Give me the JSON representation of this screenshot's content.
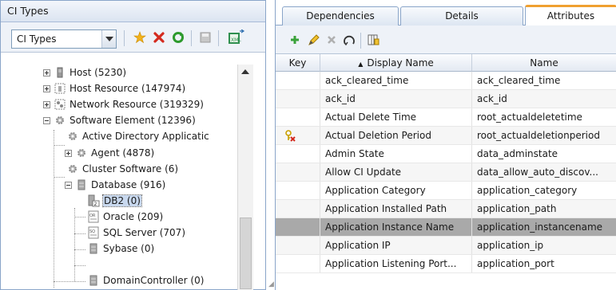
{
  "left_panel": {
    "title": "CI Types",
    "selector_value": "CI Types",
    "toolbar_icons": [
      "star-icon",
      "delete-icon",
      "refresh-icon",
      "save-icon",
      "export-xml-icon"
    ]
  },
  "tree": [
    {
      "label": "Host (5230)",
      "icon": "host-icon",
      "expander": "plus"
    },
    {
      "label": "Host Resource (147974)",
      "icon": "host-resource-icon",
      "expander": "plus"
    },
    {
      "label": "Network Resource (319329)",
      "icon": "network-resource-icon",
      "expander": "plus"
    },
    {
      "label": "Software Element (12396)",
      "icon": "gear-icon",
      "expander": "minus"
    },
    {
      "label": "Active Directory Applicatic",
      "icon": "gear-icon",
      "expander": ""
    },
    {
      "label": "Agent (4878)",
      "icon": "gear-icon",
      "expander": "plus"
    },
    {
      "label": "Cluster Software (6)",
      "icon": "gear-icon",
      "expander": ""
    },
    {
      "label": "Database (916)",
      "icon": "database-icon",
      "expander": "minus"
    },
    {
      "label": "DB2 (0)",
      "icon": "db2-icon",
      "expander": "",
      "selected": true
    },
    {
      "label": "Oracle (209)",
      "icon": "oracle-icon",
      "expander": ""
    },
    {
      "label": "SQL Server (707)",
      "icon": "sql-server-icon",
      "expander": ""
    },
    {
      "label": "Sybase (0)",
      "icon": "database-icon",
      "expander": ""
    },
    {
      "label": "DomainController (0)",
      "icon": "database-icon",
      "expander": ""
    }
  ],
  "right_panel": {
    "tabs": [
      "Dependencies",
      "Details",
      "Attributes"
    ],
    "active_tab": "Attributes",
    "toolbar_icons": [
      "add-icon",
      "edit-icon",
      "delete-icon",
      "reset-icon",
      "columns-icon"
    ],
    "columns": {
      "key": "Key",
      "display_name": "Display Name",
      "name": "Name"
    },
    "sort_indicator": "▲",
    "rows": [
      {
        "display_name": "ack_cleared_time",
        "name": "ack_cleared_time"
      },
      {
        "display_name": "ack_id",
        "name": "ack_id"
      },
      {
        "display_name": "Actual Delete Time",
        "name": "root_actualdeletetime"
      },
      {
        "display_name": "Actual Deletion Period",
        "name": "root_actualdeletionperiod",
        "key_icon": "key-x-icon"
      },
      {
        "display_name": "Admin State",
        "name": "data_adminstate"
      },
      {
        "display_name": "Allow CI Update",
        "name": "data_allow_auto_discov..."
      },
      {
        "display_name": "Application Category",
        "name": "application_category"
      },
      {
        "display_name": "Application Installed Path",
        "name": "application_path"
      },
      {
        "display_name": "Application Instance Name",
        "name": "application_instancename",
        "selected": true
      },
      {
        "display_name": "Application IP",
        "name": "application_ip"
      },
      {
        "display_name": "Application Listening Port...",
        "name": "application_port"
      }
    ]
  },
  "colors": {
    "accent": "#f0a030",
    "panel_border": "#8aa5c9",
    "selection": "#a9a9a9"
  }
}
